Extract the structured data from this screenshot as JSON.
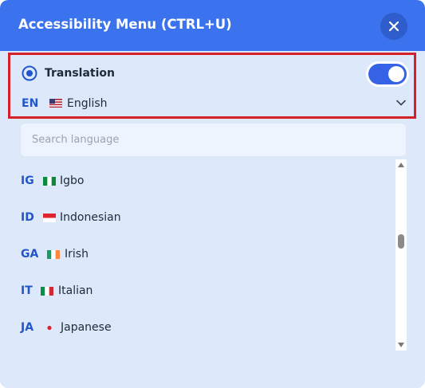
{
  "header": {
    "title": "Accessibility Menu (CTRL+U)",
    "close_icon": "close-icon"
  },
  "translation": {
    "label": "Translation",
    "enabled": true,
    "selected": {
      "code": "EN",
      "name": "English",
      "flag": "flag-us-icon"
    }
  },
  "search": {
    "placeholder": "Search language",
    "value": ""
  },
  "languages": [
    {
      "code": "IG",
      "name": "Igbo",
      "flag": "flag-nigeria-icon"
    },
    {
      "code": "ID",
      "name": "Indonesian",
      "flag": "flag-indonesia-icon"
    },
    {
      "code": "GA",
      "name": "Irish",
      "flag": "flag-ireland-icon"
    },
    {
      "code": "IT",
      "name": "Italian",
      "flag": "flag-italy-icon"
    },
    {
      "code": "JA",
      "name": "Japanese",
      "flag": "flag-japan-icon"
    }
  ],
  "colors": {
    "header": "#3b72ee",
    "panel": "#dde9fb",
    "accent": "#2356c8",
    "highlight_border": "#d3212c",
    "toggle_on": "#3663e6"
  }
}
